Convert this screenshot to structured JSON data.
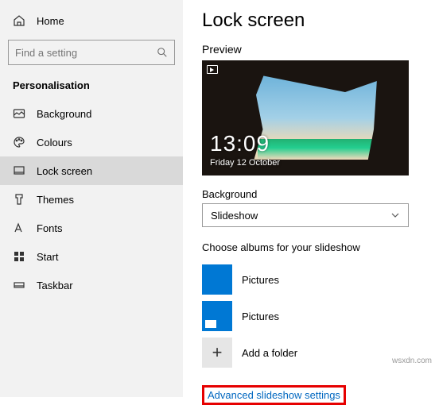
{
  "sidebar": {
    "home": "Home",
    "searchPlaceholder": "Find a setting",
    "sectionTitle": "Personalisation",
    "items": [
      {
        "label": "Background",
        "active": false
      },
      {
        "label": "Colours",
        "active": false
      },
      {
        "label": "Lock screen",
        "active": true
      },
      {
        "label": "Themes",
        "active": false
      },
      {
        "label": "Fonts",
        "active": false
      },
      {
        "label": "Start",
        "active": false
      },
      {
        "label": "Taskbar",
        "active": false
      }
    ]
  },
  "main": {
    "title": "Lock screen",
    "previewLabel": "Preview",
    "preview": {
      "time": "13:09",
      "date": "Friday 12 October"
    },
    "backgroundLabel": "Background",
    "backgroundValue": "Slideshow",
    "chooseLabel": "Choose albums for your slideshow",
    "albums": [
      {
        "label": "Pictures"
      },
      {
        "label": "Pictures"
      }
    ],
    "addFolderLabel": "Add a folder",
    "advancedLink": "Advanced slideshow settings"
  },
  "watermark": "wsxdn.com"
}
